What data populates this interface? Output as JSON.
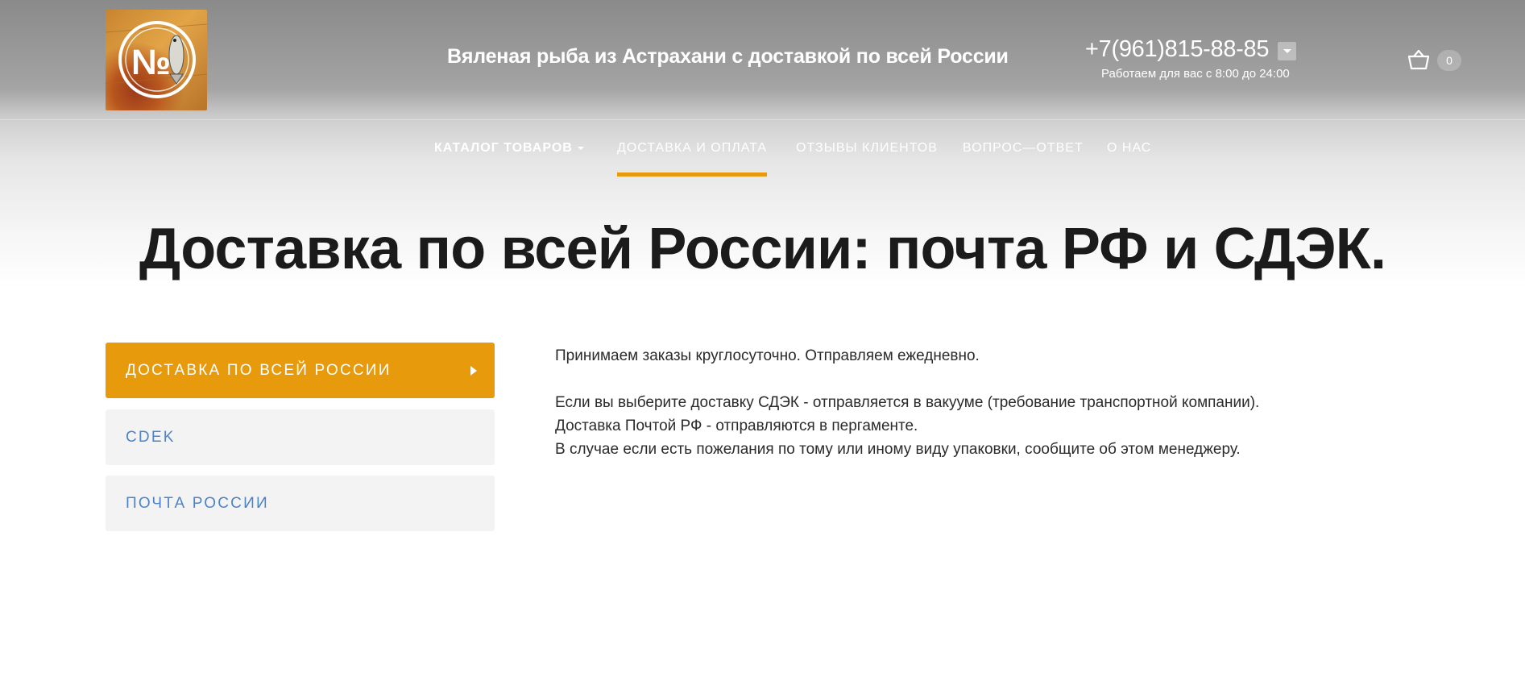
{
  "header": {
    "tagline": "Вяленая рыба из Астрахани с доставкой по всей России",
    "phone": "+7(961)815-88-85",
    "hours": "Работаем для вас с 8:00 до 24:00",
    "cart_count": "0",
    "logo_text": "№",
    "logo_icon": "fish-icon",
    "cart_icon": "basket-icon"
  },
  "nav": {
    "items": [
      {
        "label": "КАТАЛОГ ТОВАРОВ"
      },
      {
        "label": "ДОСТАВКА И ОПЛАТА"
      },
      {
        "label": "ОТЗЫВЫ КЛИЕНТОВ"
      },
      {
        "label": "ВОПРОС—ОТВЕТ"
      },
      {
        "label": "О НАС"
      }
    ],
    "active_index": 1
  },
  "page": {
    "title": "Доставка по всей России: почта РФ и СДЭК."
  },
  "sidebar": {
    "items": [
      {
        "label": "ДОСТАВКА ПО ВСЕЙ РОССИИ",
        "active": true
      },
      {
        "label": "CDEK",
        "active": false
      },
      {
        "label": "ПОЧТА РОССИИ",
        "active": false
      }
    ]
  },
  "content": {
    "lines": [
      "Принимаем заказы круглосуточно. Отправляем ежедневно.",
      "Если вы выберите доставку СДЭК - отправляется в вакууме (требование транспортной компании).",
      "Доставка Почтой РФ - отправляются в пергаменте.",
      "В случае если есть пожелания по тому или иному виду упаковки, сообщите об этом менеджеру."
    ]
  },
  "colors": {
    "accent": "#e69a0c",
    "link": "#4d84c9",
    "title": "#1b1b1b"
  }
}
